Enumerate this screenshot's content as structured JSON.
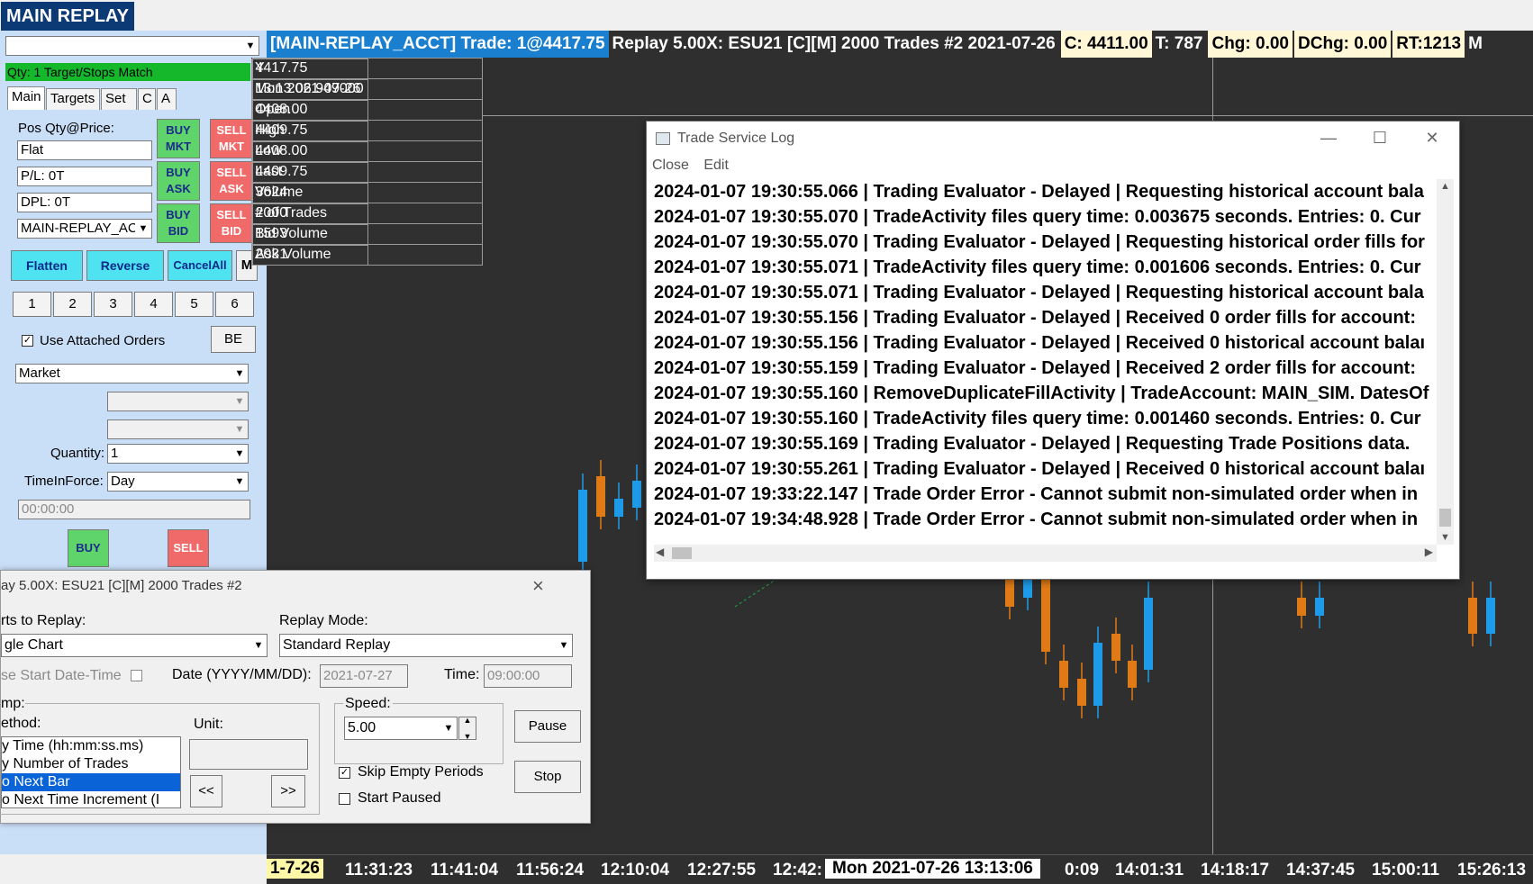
{
  "app": {
    "title": "MAIN REPLAY"
  },
  "chart": {
    "header": {
      "account": "[MAIN-REPLAY_ACCT]  Trade: 1@4417.75",
      "info": "Replay 5.00X: ESU21 [C][M]  2000 Trades #2 2021-07-26",
      "close_box": "C: 4411.00",
      "t_value": "T: 787",
      "chg_box": "Chg: 0.00",
      "dchg_box": "DChg: 0.00",
      "rt_box": "RT:1213",
      "overflow": "M"
    },
    "data_window": [
      {
        "label": "Y",
        "value": "4417.75"
      },
      {
        "label": "Mon 2021-07-26",
        "value": "13:13:06.949000"
      },
      {
        "label": "Open",
        "value": "4408.00"
      },
      {
        "label": "High",
        "value": "4409.75"
      },
      {
        "label": "Low",
        "value": "4408.00"
      },
      {
        "label": "Last",
        "value": "4409.75"
      },
      {
        "label": "Volume",
        "value": "3624"
      },
      {
        "label": "# of Trades",
        "value": "2000"
      },
      {
        "label": "Bid Volume",
        "value": "1593"
      },
      {
        "label": "Ask Volume",
        "value": "2031"
      }
    ],
    "time_axis": {
      "start": "1-7-26",
      "ticks": [
        "11:31:23",
        "11:41:04",
        "11:56:24",
        "12:10:04",
        "12:27:55",
        "12:42:",
        "0:09",
        "14:01:31",
        "14:18:17",
        "14:37:45",
        "15:00:11",
        "15:26:13"
      ],
      "cursor": "Mon 2021-07-26   13:13:06"
    },
    "colors": {
      "up": "#1e9be8",
      "down": "#e07a16",
      "background": "#2f2f2f",
      "ma": "#1aa84a"
    }
  },
  "left_panel": {
    "account_combo": "",
    "status": "Qty: 1 Target/Stops Match",
    "tabs": [
      "Main",
      "Targets",
      "Set",
      "C",
      "A"
    ],
    "pos_label": "Pos Qty@Price:",
    "pos_value": "Flat",
    "pl": "P/L: 0T",
    "dpl": "DPL: 0T",
    "account": "MAIN-REPLAY_AC",
    "buttons": {
      "buy_mkt": "BUY MKT",
      "sell_mkt": "SELL MKT",
      "buy_ask": "BUY ASK",
      "sell_ask": "SELL ASK",
      "buy_bid": "BUY BID",
      "sell_bid": "SELL BID",
      "flatten": "Flatten",
      "reverse": "Reverse",
      "cancel_all": "CancelAll",
      "more": "M",
      "be": "BE",
      "buy": "BUY",
      "sell": "SELL"
    },
    "qty_buttons": [
      "1",
      "2",
      "3",
      "4",
      "5",
      "6"
    ],
    "use_attached": "Use Attached Orders",
    "order_type": "Market",
    "quantity_label": "Quantity:",
    "quantity": "1",
    "tif_label": "TimeInForce:",
    "tif": "Day",
    "time_field": "00:00:00"
  },
  "replay_dialog": {
    "title": "ay 5.00X: ESU21 [C][M]  2000 Trades #2",
    "charts_label": "rts to Replay:",
    "charts_value": "gle Chart",
    "mode_label": "Replay Mode:",
    "mode_value": "Standard Replay",
    "use_start": "se Start Date-Time",
    "date_label": "Date (YYYY/MM/DD):",
    "date_value": "2021-07-27",
    "time_label": "Time:",
    "time_value": "09:00:00",
    "jump_label": "mp:",
    "method_label": "ethod:",
    "methods": [
      "y Time (hh:mm:ss.ms)",
      "y Number of Trades",
      "o Next Bar",
      "o Next Time Increment (I"
    ],
    "selected_method": 2,
    "unit_label": "Unit:",
    "prev": "<<",
    "next": ">>",
    "speed_label": "Speed:",
    "speed_value": "5.00",
    "skip_empty": "Skip Empty Periods",
    "start_paused": "Start Paused",
    "pause": "Pause",
    "stop": "Stop"
  },
  "log_window": {
    "title": "Trade Service Log",
    "menu": [
      "Close",
      "Edit"
    ],
    "lines": [
      "2024-01-07   19:30:55.066 | Trading Evaluator - Delayed | Requesting historical account bala",
      "2024-01-07   19:30:55.070 | TradeActivity files query time: 0.003675 seconds. Entries: 0. Cur",
      "2024-01-07   19:30:55.070 | Trading Evaluator - Delayed | Requesting historical order fills for",
      "2024-01-07   19:30:55.071 | TradeActivity files query time: 0.001606 seconds. Entries: 0. Cur",
      "2024-01-07   19:30:55.071 | Trading Evaluator - Delayed | Requesting historical account bala",
      "2024-01-07   19:30:55.156 | Trading Evaluator - Delayed | Received 0 order fills for account:",
      "2024-01-07   19:30:55.156 | Trading Evaluator - Delayed | Received 0 historical account balaı",
      "2024-01-07   19:30:55.159 | Trading Evaluator - Delayed | Received 2 order fills for account:",
      "2024-01-07   19:30:55.160 | RemoveDuplicateFillActivity | TradeAccount: MAIN_SIM. DatesOf",
      "2024-01-07   19:30:55.160 | TradeActivity files query time: 0.001460 seconds. Entries: 0. Cur",
      "2024-01-07   19:30:55.169 | Trading Evaluator - Delayed | Requesting Trade Positions data.",
      "2024-01-07   19:30:55.261 | Trading Evaluator - Delayed | Received 0 historical account balaı",
      "2024-01-07   19:33:22.147 | Trade Order Error - Cannot submit non-simulated order when in",
      "2024-01-07   19:34:48.928 | Trade Order Error - Cannot submit non-simulated order when in"
    ]
  }
}
